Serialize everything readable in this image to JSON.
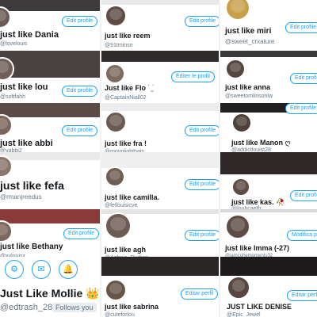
{
  "collage": {
    "profiles": [
      {
        "id": "dania",
        "name": "just like Dania",
        "handle": "@lovelouis",
        "button": "Edit profile",
        "banner": "#3c3a3a",
        "avatar": "#6b5a55"
      },
      {
        "id": "reem",
        "name": "just like reem",
        "handle": "@91tminsn",
        "button": "Edit profile",
        "banner": "#e8e8e8",
        "avatar": "#5e4b44"
      },
      {
        "id": "miri",
        "name": "just like miri",
        "handle": "@sweet_crxature",
        "button": "Edit profile",
        "banner": "#efefef",
        "avatar": "#c9a04a"
      },
      {
        "id": "lou",
        "name": "just like lou",
        "handle": "@softfahh",
        "button": "Edit profile",
        "banner": "#4a4141",
        "avatar": "#6f5f58"
      },
      {
        "id": "flo",
        "name": "Just like Flo",
        "name_suffix": "˙ ̫˙",
        "handle": "@CaptainNiall02",
        "button": "Éditer le profil",
        "banner": "#2f2b2b",
        "avatar": "#7d6b61"
      },
      {
        "id": "anna",
        "name": "just like anna",
        "handle": "@sweetomlinsonlw",
        "button": "Edit profile",
        "banner": "#3a3a3a",
        "avatar": "#55463f"
      },
      {
        "id": "abbi",
        "name": "just like abbi",
        "handle": "@yabbi2",
        "button": "Edit profile",
        "banner": "#5a4b46",
        "avatar": "#7a665c"
      },
      {
        "id": "fra",
        "name": "just like fra !",
        "handle": "@movnlighthais",
        "button": "Edit profile",
        "banner": "#ededed",
        "avatar": "#6a5a52"
      },
      {
        "id": "manon",
        "name": "just like Manon",
        "name_suffix": "ღ",
        "handle": "@addictlouist28",
        "button": "Edit profile",
        "banner": "#1f1f1f",
        "avatar": "#4d3f3a"
      },
      {
        "id": "fefa",
        "name": "just like fefa",
        "handle": "@rmanjreedus",
        "button": "",
        "banner": "#e9e9e9",
        "avatar": "#8a766b"
      },
      {
        "id": "camilla",
        "name": "just like camilla.",
        "handle": "@fellouisicve",
        "button": "Edit profile",
        "banner": "#efefef",
        "avatar": "#6e5d55"
      },
      {
        "id": "kas",
        "name": "just like kas.",
        "name_suffix": "🥀",
        "handle": "@louhcaeth",
        "button": "Edit profile",
        "banner": "#2e2828",
        "avatar": "#5c4c44"
      },
      {
        "id": "bethany",
        "name": "just like Bethany",
        "handle": "@xylouisx",
        "button": "Edit profile",
        "banner": "#8b3a3a",
        "avatar": "#7b675d"
      },
      {
        "id": "agh",
        "name": "just like agh",
        "handle": "@Aghnia_Rudian",
        "button": "Edit profile",
        "banner": "#e4e4e4",
        "avatar": "#6d5c53"
      },
      {
        "id": "imma",
        "name": "just like Imma (-27)",
        "handle": "@iamcohemoments32",
        "button": "Modifica p",
        "banner": "#d8d8d8",
        "avatar": "#5d4c45"
      },
      {
        "id": "mollie",
        "name": "Just Like Mollie",
        "name_suffix": "👑",
        "handle": "@edtrash_28",
        "button": "",
        "follows_label": "Follows you",
        "banner": "#3b3535",
        "avatar": "#7e6a5f"
      },
      {
        "id": "sabrina",
        "name": "just like sabrina",
        "handle": "@cuteforlou",
        "button": "Editar perfil",
        "banner": "#2a2626",
        "avatar": "#665448"
      },
      {
        "id": "denise",
        "name": "JUST LIKE DENISE",
        "handle": "@Epic_Jewel",
        "button": "Editar perfil",
        "banner": "#1d1b1b",
        "avatar": "#574640"
      }
    ],
    "mollie_actions": [
      {
        "id": "settings",
        "icon": "gear-icon",
        "glyph": "⚙"
      },
      {
        "id": "message",
        "icon": "envelope-icon",
        "glyph": "✉"
      },
      {
        "id": "notify",
        "icon": "bell-plus-icon",
        "glyph": "🔔"
      }
    ],
    "colors": {
      "accent": "#1da1f2",
      "name": "#14171a",
      "handle": "#657786"
    }
  }
}
